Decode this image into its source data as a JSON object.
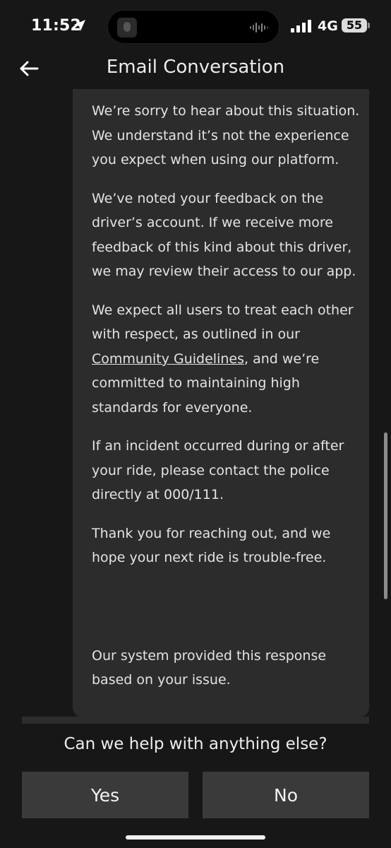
{
  "status_bar": {
    "time": "11:52",
    "network": "4G",
    "battery": "55"
  },
  "header": {
    "title": "Email Conversation"
  },
  "message": {
    "p1": "We’re sorry to hear about this situation. We understand it’s not the experience you expect when using our platform.",
    "p2": "We’ve noted your feedback on the driver’s account. If we receive more feedback of this kind about this driver, we may review their access to our app.",
    "p3_before": "We expect all users to treat each other with respect, as outlined in our ",
    "p3_link": "Community Guidelines",
    "p3_after": ", and we’re committed to maintaining high standards for everyone.",
    "p4": "If an incident occurred during or after your ride, please contact the police directly at 000/111.",
    "p5": "Thank you for reaching out, and we hope your next ride is trouble-free.",
    "p6": "Our system provided this response based on your issue."
  },
  "prompt": {
    "question": "Can we help with anything else?",
    "yes_label": "Yes",
    "no_label": "No"
  },
  "colors": {
    "background": "#171717",
    "card": "#2c2c2c",
    "button": "#3a3a3a"
  },
  "icons": {
    "back": "arrow-left-icon",
    "location": "location-arrow-icon",
    "signal": "cellular-signal-icon"
  }
}
